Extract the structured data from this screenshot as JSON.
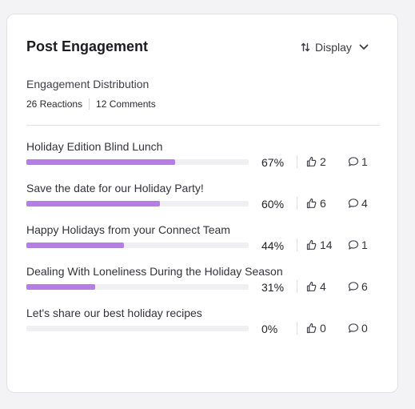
{
  "card": {
    "title": "Post Engagement",
    "display_button": {
      "label": "Display"
    },
    "subtitle": "Engagement Distribution",
    "stats": {
      "reactions": "26 Reactions",
      "comments": "12 Comments"
    }
  },
  "posts": [
    {
      "title": "Holiday Edition Blind Lunch",
      "percent_label": "67%",
      "fraction": 0.67,
      "likes": "2",
      "comments": "1"
    },
    {
      "title": "Save the date for our Holiday Party!",
      "percent_label": "60%",
      "fraction": 0.6,
      "likes": "6",
      "comments": "4"
    },
    {
      "title": "Happy Holidays from your Connect Team",
      "percent_label": "44%",
      "fraction": 0.44,
      "likes": "14",
      "comments": "1"
    },
    {
      "title": "Dealing With Loneliness During the Holiday Season",
      "percent_label": "31%",
      "fraction": 0.31,
      "likes": "4",
      "comments": "6"
    },
    {
      "title": "Let's share our best holiday recipes",
      "percent_label": "0%",
      "fraction": 0,
      "likes": "0",
      "comments": "0"
    }
  ],
  "colors": {
    "bar_fill": "#b57de6",
    "bar_track": "#f0f0f2"
  },
  "icons": {
    "sort": "sort-arrows-icon",
    "chevron": "chevron-down-icon",
    "like": "thumbs-up-icon",
    "comment": "comment-bubble-icon"
  }
}
